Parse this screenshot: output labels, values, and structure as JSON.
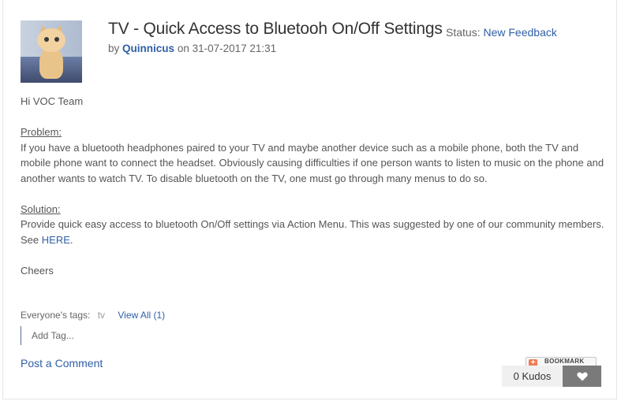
{
  "header": {
    "title": "TV - Quick Access to Bluetooh On/Off Settings",
    "status_label": "Status:",
    "status_value": "New Feedback",
    "by_label": "by",
    "author": "Quinnicus",
    "date": "on 31-07-2017 21:31"
  },
  "body": {
    "greeting": "Hi VOC Team",
    "problem_heading": "Problem:",
    "problem_text": "If you have a bluetooth headphones paired to your TV and maybe another device such as a mobile phone, both the TV and mobile phone want to connect the headset.  Obviously causing difficulties if one person wants to listen to music on the phone and another wants to watch TV.  To disable bluetooth on the TV, one must go through many menus to do so.",
    "solution_heading": "Solution:",
    "solution_text": "Provide quick easy access to bluetooth On/Off settings via Action Menu.  This was suggested by one of our community members.  See",
    "solution_link": "HERE",
    "solution_end": ".",
    "closing": "Cheers"
  },
  "tags": {
    "label": "Everyone's tags:",
    "items": [
      "tv"
    ],
    "view_all": "View All (1)",
    "add_tag_placeholder": "Add Tag..."
  },
  "footer": {
    "post_comment": "Post a Comment",
    "bookmark_label": "BOOKMARK",
    "kudos_count": "0 Kudos"
  },
  "icons": {
    "bookmark": "plus-icon",
    "kudo": "heart-icon"
  },
  "colors": {
    "link": "#2f5fa7",
    "kudo_button": "#7a7a7a",
    "bookmark_accent": "#f27b52"
  }
}
